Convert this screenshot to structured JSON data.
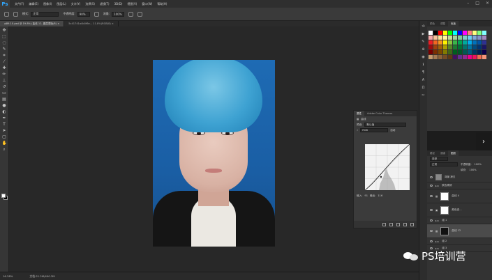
{
  "app": {
    "logo": "Ps"
  },
  "menubar": {
    "items": [
      "文件(F)",
      "编辑(E)",
      "图像(I)",
      "图层(L)",
      "文字(Y)",
      "选择(S)",
      "滤镜(T)",
      "3D(D)",
      "视图(V)",
      "窗口(W)",
      "帮助(H)"
    ],
    "controls": [
      "–",
      "□",
      "×"
    ]
  },
  "options": {
    "mode_label": "模式:",
    "mode_value": "正常",
    "opacity_label": "不透明度:",
    "opacity_value": "90%",
    "flow_label": "流量:",
    "flow_value": "100%"
  },
  "tabs": [
    {
      "label": "zj89.10.psd @ 19.8% (曲线 12, 图层蒙版/8) ×",
      "active": true
    },
    {
      "label": "5c41741a4b0f6e... 11.8%(RGB/8) ×",
      "active": false
    }
  ],
  "curves": {
    "tabs": [
      "属性",
      "Adobe Color Themes"
    ],
    "title": "曲线",
    "preset_label": "预设:",
    "preset_value": "默认值",
    "channel_value": "RGB",
    "auto_label": "自动",
    "input_label": "输入:",
    "input_value": "91",
    "output_label": "输出:",
    "output_value": "116"
  },
  "swatches": {
    "tabs": [
      "颜色",
      "调整",
      "色板"
    ],
    "active_tab": "色板"
  },
  "swatch_colors": [
    "#ffffff",
    "#000000",
    "#ff0000",
    "#ffff00",
    "#00ff00",
    "#00ffff",
    "#0000ff",
    "#ff00ff",
    "#ff8080",
    "#ffff80",
    "#80ff80",
    "#80ffff",
    "#f4a6a6",
    "#f7c39a",
    "#fbe39b",
    "#fff79c",
    "#c4df9b",
    "#a2d39c",
    "#82ca9d",
    "#7bcdc8",
    "#6ecff6",
    "#7ea7d8",
    "#8493ca",
    "#a187be",
    "#ed1c24",
    "#f26522",
    "#f7941d",
    "#fff200",
    "#8dc63f",
    "#39b54a",
    "#00a651",
    "#00a99d",
    "#00aeef",
    "#0072bc",
    "#0054a6",
    "#2e3192",
    "#9e0b0f",
    "#a0410d",
    "#a36209",
    "#aba000",
    "#598527",
    "#1a7b30",
    "#007236",
    "#00746b",
    "#0076a3",
    "#004b80",
    "#003471",
    "#1b1464",
    "#790000",
    "#7b2e00",
    "#7d4900",
    "#827b00",
    "#406618",
    "#005e20",
    "#005826",
    "#005952",
    "#005b7f",
    "#003663",
    "#002157",
    "#0d004c",
    "#c69c6e",
    "#a67c52",
    "#8c6239",
    "#754c24",
    "#603913",
    "#440e62",
    "#662d91",
    "#92278f",
    "#ec008c",
    "#ed145b",
    "#f26c4f",
    "#f69679"
  ],
  "layers": {
    "tabs": [
      "图层",
      "通道",
      "路径"
    ],
    "kind_label": "类型",
    "blend_value": "正常",
    "opacity_label": "不透明度:",
    "opacity_value": "100%",
    "fill_label": "填充:",
    "fill_value": "100%",
    "items": [
      {
        "name": "背景 拷贝",
        "selected": false
      },
      {
        "name": "肤色精修",
        "selected": false
      },
      {
        "name": "曲线 4",
        "selected": false
      },
      {
        "name": "颜色查...",
        "selected": false
      },
      {
        "name": "组 1",
        "selected": false
      },
      {
        "name": "曲线 12",
        "selected": true
      },
      {
        "name": "组 2",
        "selected": false
      },
      {
        "name": "组 3",
        "selected": false
      }
    ]
  },
  "status": {
    "zoom": "16.38%",
    "doc_info": "文档:21.2M/400.3M"
  },
  "watermark": {
    "text": "PS培训营"
  }
}
